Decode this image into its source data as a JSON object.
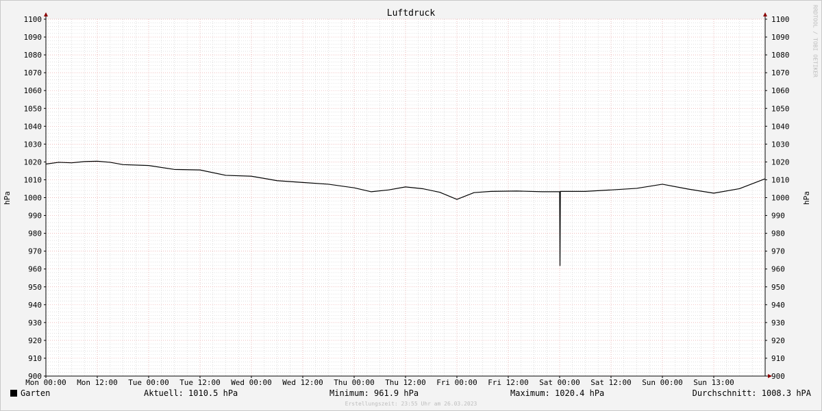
{
  "chart_data": {
    "type": "line",
    "title": "Luftdruck",
    "ylabel": "hPa",
    "ylim": [
      900,
      1100
    ],
    "ytick_step": 10,
    "minor_ytick_step": 2,
    "xlim": [
      "2023-03-20 00:00",
      "2023-03-26 23:55"
    ],
    "xtick_labels": [
      "Mon 00:00",
      "Mon 12:00",
      "Tue 00:00",
      "Tue 12:00",
      "Wed 00:00",
      "Wed 12:00",
      "Thu 00:00",
      "Thu 12:00",
      "Fri 00:00",
      "Fri 12:00",
      "Sat 00:00",
      "Sat 12:00",
      "Sun 00:00",
      "Sun 13:00"
    ],
    "grid": true,
    "legend_position": "bottom-left",
    "colors": {
      "background": "#f3f3f3",
      "plot": "#ffffff",
      "line": "#000000",
      "major_grid": "#e8a0a0",
      "minor_grid": "#cccccc",
      "arrow": "#8b0000"
    },
    "series": [
      {
        "name": "Garten",
        "x": [
          "2023-03-20 00:00",
          "2023-03-20 03:00",
          "2023-03-20 06:00",
          "2023-03-20 09:00",
          "2023-03-20 12:00",
          "2023-03-20 15:00",
          "2023-03-20 18:00",
          "2023-03-21 00:00",
          "2023-03-21 06:00",
          "2023-03-21 12:00",
          "2023-03-21 18:00",
          "2023-03-22 00:00",
          "2023-03-22 06:00",
          "2023-03-22 12:00",
          "2023-03-22 18:00",
          "2023-03-23 00:00",
          "2023-03-23 04:00",
          "2023-03-23 08:00",
          "2023-03-23 12:00",
          "2023-03-23 16:00",
          "2023-03-23 20:00",
          "2023-03-24 00:00",
          "2023-03-24 04:00",
          "2023-03-24 08:00",
          "2023-03-24 14:00",
          "2023-03-24 20:00",
          "2023-03-25 00:00",
          "2023-03-25 00:05",
          "2023-03-25 00:10",
          "2023-03-25 06:00",
          "2023-03-25 12:00",
          "2023-03-25 18:00",
          "2023-03-26 00:00",
          "2023-03-26 06:00",
          "2023-03-26 12:00",
          "2023-03-26 18:00",
          "2023-03-26 23:55"
        ],
        "values": [
          1018.8,
          1019.8,
          1019.5,
          1020.2,
          1020.4,
          1019.8,
          1018.5,
          1018.0,
          1015.8,
          1015.5,
          1012.5,
          1012.0,
          1009.5,
          1008.5,
          1007.5,
          1005.5,
          1003.3,
          1004.3,
          1006.0,
          1005.0,
          1003.0,
          999.0,
          1002.8,
          1003.5,
          1003.7,
          1003.3,
          1003.3,
          961.9,
          1003.5,
          1003.5,
          1004.3,
          1005.2,
          1007.5,
          1004.8,
          1002.5,
          1005.0,
          1010.5
        ]
      }
    ],
    "legend": {
      "series_name": "Garten",
      "current": "Aktuell: 1010.5 hPa",
      "minimum": "Minimum: 961.9 hPa",
      "maximum": "Maximum: 1020.4 hPa",
      "average": "Durchschnitt: 1008.3 hPA"
    },
    "footer": "Erstellungszeit: 23:55 Uhr am 26.03.2023",
    "watermark": "RRDTOOL / TOBI OETIKER"
  }
}
